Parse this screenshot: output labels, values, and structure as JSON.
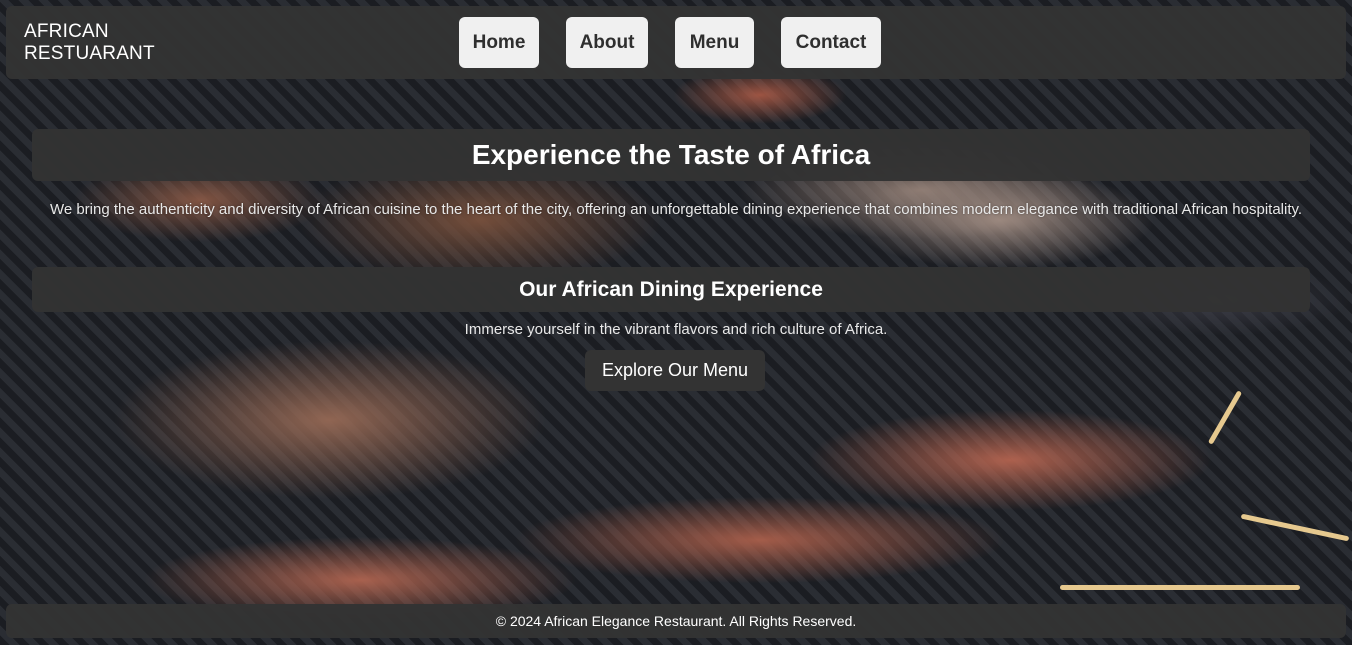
{
  "header": {
    "logo_line1": "AFRICAN",
    "logo_line2": "RESTUARANT",
    "nav": {
      "home": "Home",
      "about": "About",
      "menu": "Menu",
      "contact": "Contact"
    }
  },
  "hero": {
    "title": "Experience the Taste of Africa",
    "intro": "We bring the authenticity and diversity of African cuisine to the heart of the city, offering an unforgettable dining experience that combines modern elegance with traditional African hospitality."
  },
  "experience": {
    "heading": "Our African Dining Experience",
    "text": "Immerse yourself in the vibrant flavors and rich culture of Africa.",
    "cta_label": "Explore Our Menu"
  },
  "footer": {
    "text": "© 2024 African Elegance Restaurant. All Rights Reserved."
  },
  "colors": {
    "panel": "#333333",
    "nav_button": "#f0f0f0",
    "text_light": "#ffffff"
  }
}
